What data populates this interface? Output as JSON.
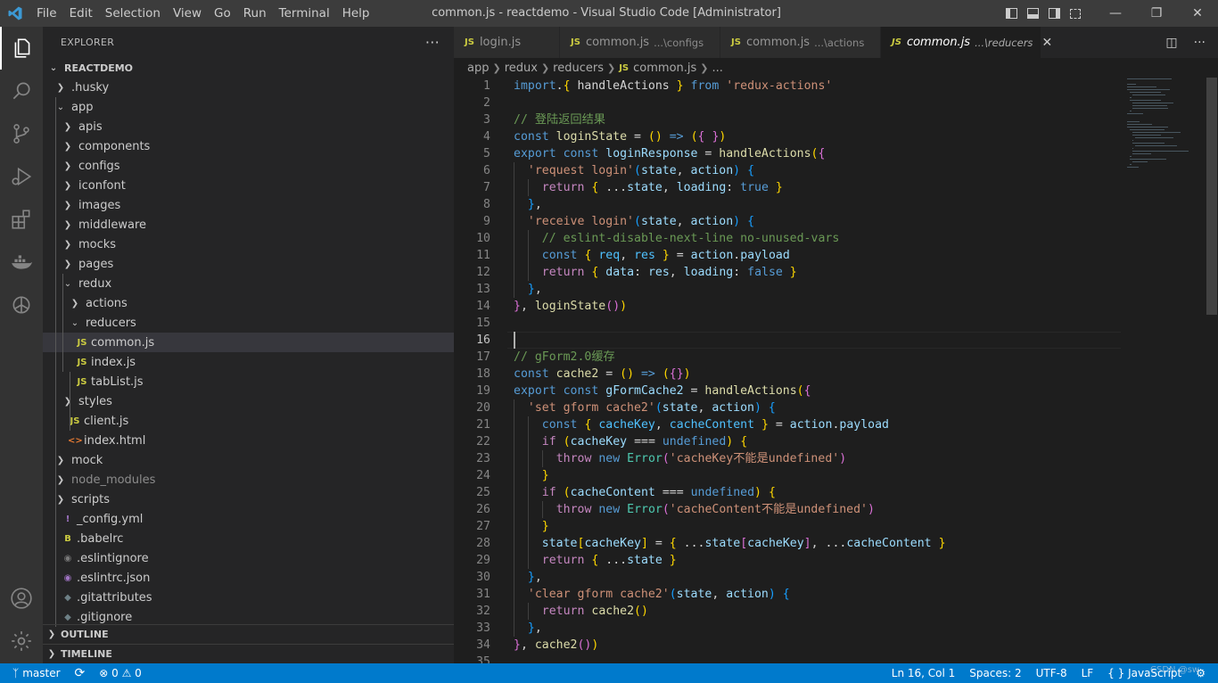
{
  "window": {
    "title": "common.js - reactdemo - Visual Studio Code [Administrator]",
    "logo": "VS Code logo",
    "menu": [
      "File",
      "Edit",
      "Selection",
      "View",
      "Go",
      "Run",
      "Terminal",
      "Help"
    ]
  },
  "activity": [
    {
      "name": "explorer-icon"
    },
    {
      "name": "search-icon"
    },
    {
      "name": "source-control-icon"
    },
    {
      "name": "run-debug-icon"
    },
    {
      "name": "extensions-icon"
    },
    {
      "name": "docker-icon"
    },
    {
      "name": "openai-icon"
    }
  ],
  "explorer": {
    "header": "EXPLORER",
    "more": "···",
    "root": "REACTDEMO",
    "items": [
      {
        "label": ".husky",
        "type": "folder",
        "depth": 1
      },
      {
        "label": "app",
        "type": "folder-open",
        "depth": 1
      },
      {
        "label": "apis",
        "type": "folder",
        "depth": 2
      },
      {
        "label": "components",
        "type": "folder",
        "depth": 2
      },
      {
        "label": "configs",
        "type": "folder",
        "depth": 2
      },
      {
        "label": "iconfont",
        "type": "folder",
        "depth": 2
      },
      {
        "label": "images",
        "type": "folder",
        "depth": 2
      },
      {
        "label": "middleware",
        "type": "folder",
        "depth": 2
      },
      {
        "label": "mocks",
        "type": "folder",
        "depth": 2
      },
      {
        "label": "pages",
        "type": "folder",
        "depth": 2
      },
      {
        "label": "redux",
        "type": "folder-open",
        "depth": 2
      },
      {
        "label": "actions",
        "type": "folder",
        "depth": 3
      },
      {
        "label": "reducers",
        "type": "folder-open",
        "depth": 3
      },
      {
        "label": "common.js",
        "type": "js",
        "depth": 4,
        "selected": true
      },
      {
        "label": "index.js",
        "type": "js",
        "depth": 4
      },
      {
        "label": "tabList.js",
        "type": "js",
        "depth": 4
      },
      {
        "label": "styles",
        "type": "folder",
        "depth": 2
      },
      {
        "label": "client.js",
        "type": "js",
        "depth": 3
      },
      {
        "label": "index.html",
        "type": "html",
        "depth": 3
      },
      {
        "label": "mock",
        "type": "folder",
        "depth": 1
      },
      {
        "label": "node_modules",
        "type": "folder",
        "depth": 1,
        "dim": true
      },
      {
        "label": "scripts",
        "type": "folder",
        "depth": 1
      },
      {
        "label": "_config.yml",
        "type": "yml",
        "depth": 2
      },
      {
        "label": ".babelrc",
        "type": "babel",
        "depth": 2
      },
      {
        "label": ".eslintignore",
        "type": "eslint",
        "depth": 2
      },
      {
        "label": ".eslintrc.json",
        "type": "eslintrc",
        "depth": 2
      },
      {
        "label": ".gitattributes",
        "type": "git",
        "depth": 2
      },
      {
        "label": ".gitignore",
        "type": "git",
        "depth": 2
      }
    ],
    "outline": "OUTLINE",
    "timeline": "TIMELINE"
  },
  "tabs": [
    {
      "label": "login.js",
      "desc": ""
    },
    {
      "label": "common.js",
      "desc": "...\\configs"
    },
    {
      "label": "common.js",
      "desc": "...\\actions"
    },
    {
      "label": "common.js",
      "desc": "...\\reducers",
      "active": true
    }
  ],
  "breadcrumb": {
    "a": "app",
    "b": "redux",
    "c": "reducers",
    "d": "common.js",
    "e": "..."
  },
  "editor": {
    "current_line": 16,
    "lines": [
      [
        [
          "kw",
          "import"
        ],
        [
          "",
          "."
        ],
        [
          "p1",
          "{"
        ],
        [
          "",
          " handleActions "
        ],
        [
          "p1",
          "}"
        ],
        [
          "",
          " "
        ],
        [
          "kw",
          "from"
        ],
        [
          "",
          " "
        ],
        [
          "str",
          "'redux-actions'"
        ]
      ],
      [],
      [
        [
          "cm",
          "// 登陆返回结果"
        ]
      ],
      [
        [
          "kw",
          "const"
        ],
        [
          "",
          " "
        ],
        [
          "fn",
          "loginState"
        ],
        [
          "",
          " = "
        ],
        [
          "p1",
          "()"
        ],
        [
          "",
          " "
        ],
        [
          "kw",
          "=>"
        ],
        [
          "",
          " "
        ],
        [
          "p1",
          "("
        ],
        [
          "p2",
          "{"
        ],
        [
          "",
          " "
        ],
        [
          "p2",
          "}"
        ],
        [
          "p1",
          ")"
        ]
      ],
      [
        [
          "kw",
          "export"
        ],
        [
          "",
          " "
        ],
        [
          "kw",
          "const"
        ],
        [
          "",
          " "
        ],
        [
          "var",
          "loginResponse"
        ],
        [
          "",
          " = "
        ],
        [
          "fn",
          "handleActions"
        ],
        [
          "p1",
          "("
        ],
        [
          "p2",
          "{"
        ]
      ],
      [
        [
          "",
          ""
        ],
        [
          "str",
          "'request login'"
        ],
        [
          "p3",
          "("
        ],
        [
          "var",
          "state"
        ],
        [
          "",
          ", "
        ],
        [
          "var",
          "action"
        ],
        [
          "p3",
          ")"
        ],
        [
          "",
          " "
        ],
        [
          "p3",
          "{"
        ]
      ],
      [
        [
          "ctl",
          "return"
        ],
        [
          "",
          " "
        ],
        [
          "p1",
          "{"
        ],
        [
          "",
          " ..."
        ],
        [
          "var",
          "state"
        ],
        [
          "",
          ", "
        ],
        [
          "var",
          "loading"
        ],
        [
          "",
          ": "
        ],
        [
          "kw",
          "true"
        ],
        [
          "",
          " "
        ],
        [
          "p1",
          "}"
        ]
      ],
      [
        [
          "p3",
          "}"
        ],
        [
          "",
          ","
        ]
      ],
      [
        [
          "str",
          "'receive login'"
        ],
        [
          "p3",
          "("
        ],
        [
          "var",
          "state"
        ],
        [
          "",
          ", "
        ],
        [
          "var",
          "action"
        ],
        [
          "p3",
          ")"
        ],
        [
          "",
          " "
        ],
        [
          "p3",
          "{"
        ]
      ],
      [
        [
          "cm",
          "// eslint-disable-next-line no-unused-vars"
        ]
      ],
      [
        [
          "kw",
          "const"
        ],
        [
          "",
          " "
        ],
        [
          "p1",
          "{"
        ],
        [
          "",
          " "
        ],
        [
          "cst",
          "req"
        ],
        [
          "",
          ", "
        ],
        [
          "cst",
          "res"
        ],
        [
          "",
          " "
        ],
        [
          "p1",
          "}"
        ],
        [
          "",
          " = "
        ],
        [
          "var",
          "action"
        ],
        [
          "",
          "."
        ],
        [
          "var",
          "payload"
        ]
      ],
      [
        [
          "ctl",
          "return"
        ],
        [
          "",
          " "
        ],
        [
          "p1",
          "{"
        ],
        [
          "",
          " "
        ],
        [
          "var",
          "data"
        ],
        [
          "",
          ": "
        ],
        [
          "var",
          "res"
        ],
        [
          "",
          ", "
        ],
        [
          "var",
          "loading"
        ],
        [
          "",
          ": "
        ],
        [
          "kw",
          "false"
        ],
        [
          "",
          " "
        ],
        [
          "p1",
          "}"
        ]
      ],
      [
        [
          "p3",
          "}"
        ],
        [
          "",
          ","
        ]
      ],
      [
        [
          "p2",
          "}"
        ],
        [
          "",
          ", "
        ],
        [
          "fn",
          "loginState"
        ],
        [
          "p2",
          "()"
        ],
        [
          "p1",
          ")"
        ]
      ],
      [],
      [],
      [
        [
          "cm",
          "// gForm2.0缓存"
        ]
      ],
      [
        [
          "kw",
          "const"
        ],
        [
          "",
          " "
        ],
        [
          "fn",
          "cache2"
        ],
        [
          "",
          " = "
        ],
        [
          "p1",
          "()"
        ],
        [
          "",
          " "
        ],
        [
          "kw",
          "=>"
        ],
        [
          "",
          " "
        ],
        [
          "p1",
          "("
        ],
        [
          "p2",
          "{}"
        ],
        [
          "p1",
          ")"
        ]
      ],
      [
        [
          "kw",
          "export"
        ],
        [
          "",
          " "
        ],
        [
          "kw",
          "const"
        ],
        [
          "",
          " "
        ],
        [
          "var",
          "gFormCache2"
        ],
        [
          "",
          " = "
        ],
        [
          "fn",
          "handleActions"
        ],
        [
          "p1",
          "("
        ],
        [
          "p2",
          "{"
        ]
      ],
      [
        [
          "str",
          "'set gform cache2'"
        ],
        [
          "p3",
          "("
        ],
        [
          "var",
          "state"
        ],
        [
          "",
          ", "
        ],
        [
          "var",
          "action"
        ],
        [
          "p3",
          ")"
        ],
        [
          "",
          " "
        ],
        [
          "p3",
          "{"
        ]
      ],
      [
        [
          "kw",
          "const"
        ],
        [
          "",
          " "
        ],
        [
          "p1",
          "{"
        ],
        [
          "",
          " "
        ],
        [
          "cst",
          "cacheKey"
        ],
        [
          "",
          ", "
        ],
        [
          "cst",
          "cacheContent"
        ],
        [
          "",
          " "
        ],
        [
          "p1",
          "}"
        ],
        [
          "",
          " = "
        ],
        [
          "var",
          "action"
        ],
        [
          "",
          "."
        ],
        [
          "var",
          "payload"
        ]
      ],
      [
        [
          "ctl",
          "if"
        ],
        [
          "",
          " "
        ],
        [
          "p1",
          "("
        ],
        [
          "var",
          "cacheKey"
        ],
        [
          "",
          " === "
        ],
        [
          "kw",
          "undefined"
        ],
        [
          "p1",
          ")"
        ],
        [
          "",
          " "
        ],
        [
          "p1",
          "{"
        ]
      ],
      [
        [
          "ctl",
          "throw"
        ],
        [
          "",
          " "
        ],
        [
          "kw",
          "new"
        ],
        [
          "",
          " "
        ],
        [
          "ty",
          "Error"
        ],
        [
          "p2",
          "("
        ],
        [
          "str",
          "'cacheKey不能是undefined'"
        ],
        [
          "p2",
          ")"
        ]
      ],
      [
        [
          "p1",
          "}"
        ]
      ],
      [
        [
          "ctl",
          "if"
        ],
        [
          "",
          " "
        ],
        [
          "p1",
          "("
        ],
        [
          "var",
          "cacheContent"
        ],
        [
          "",
          " === "
        ],
        [
          "kw",
          "undefined"
        ],
        [
          "p1",
          ")"
        ],
        [
          "",
          " "
        ],
        [
          "p1",
          "{"
        ]
      ],
      [
        [
          "ctl",
          "throw"
        ],
        [
          "",
          " "
        ],
        [
          "kw",
          "new"
        ],
        [
          "",
          " "
        ],
        [
          "ty",
          "Error"
        ],
        [
          "p2",
          "("
        ],
        [
          "str",
          "'cacheContent不能是undefined'"
        ],
        [
          "p2",
          ")"
        ]
      ],
      [
        [
          "p1",
          "}"
        ]
      ],
      [
        [
          "var",
          "state"
        ],
        [
          "p1",
          "["
        ],
        [
          "var",
          "cacheKey"
        ],
        [
          "p1",
          "]"
        ],
        [
          "",
          " = "
        ],
        [
          "p1",
          "{"
        ],
        [
          "",
          " ..."
        ],
        [
          "var",
          "state"
        ],
        [
          "p2",
          "["
        ],
        [
          "var",
          "cacheKey"
        ],
        [
          "p2",
          "]"
        ],
        [
          "",
          ", ..."
        ],
        [
          "var",
          "cacheContent"
        ],
        [
          "",
          " "
        ],
        [
          "p1",
          "}"
        ]
      ],
      [
        [
          "ctl",
          "return"
        ],
        [
          "",
          " "
        ],
        [
          "p1",
          "{"
        ],
        [
          "",
          " ..."
        ],
        [
          "var",
          "state"
        ],
        [
          "",
          " "
        ],
        [
          "p1",
          "}"
        ]
      ],
      [
        [
          "p3",
          "}"
        ],
        [
          "",
          ","
        ]
      ],
      [
        [
          "str",
          "'clear gform cache2'"
        ],
        [
          "p3",
          "("
        ],
        [
          "var",
          "state"
        ],
        [
          "",
          ", "
        ],
        [
          "var",
          "action"
        ],
        [
          "p3",
          ")"
        ],
        [
          "",
          " "
        ],
        [
          "p3",
          "{"
        ]
      ],
      [
        [
          "ctl",
          "return"
        ],
        [
          "",
          " "
        ],
        [
          "fn",
          "cache2"
        ],
        [
          "p1",
          "()"
        ]
      ],
      [
        [
          "p3",
          "}"
        ],
        [
          "",
          ","
        ]
      ],
      [
        [
          "p2",
          "}"
        ],
        [
          "",
          ", "
        ],
        [
          "fn",
          "cache2"
        ],
        [
          "p2",
          "()"
        ],
        [
          "p1",
          ")"
        ]
      ],
      []
    ],
    "indents": [
      0,
      0,
      0,
      0,
      0,
      1,
      2,
      1,
      1,
      2,
      2,
      2,
      1,
      0,
      0,
      0,
      0,
      0,
      0,
      1,
      2,
      2,
      3,
      2,
      2,
      3,
      2,
      2,
      2,
      1,
      1,
      2,
      1,
      0,
      0
    ]
  },
  "status": {
    "branch": "master",
    "sync": "⟳",
    "problems": "⊗ 0 ⚠ 0",
    "position": "Ln 16, Col 1",
    "spaces": "Spaces: 2",
    "encoding": "UTF-8",
    "eol": "LF",
    "language": "{ } JavaScript",
    "watermark": "CSDN @sw"
  },
  "colors": {
    "accent": "#007acc",
    "titlebar": "#3c3c3c",
    "sidebar": "#252526",
    "editor": "#1e1e1e"
  }
}
